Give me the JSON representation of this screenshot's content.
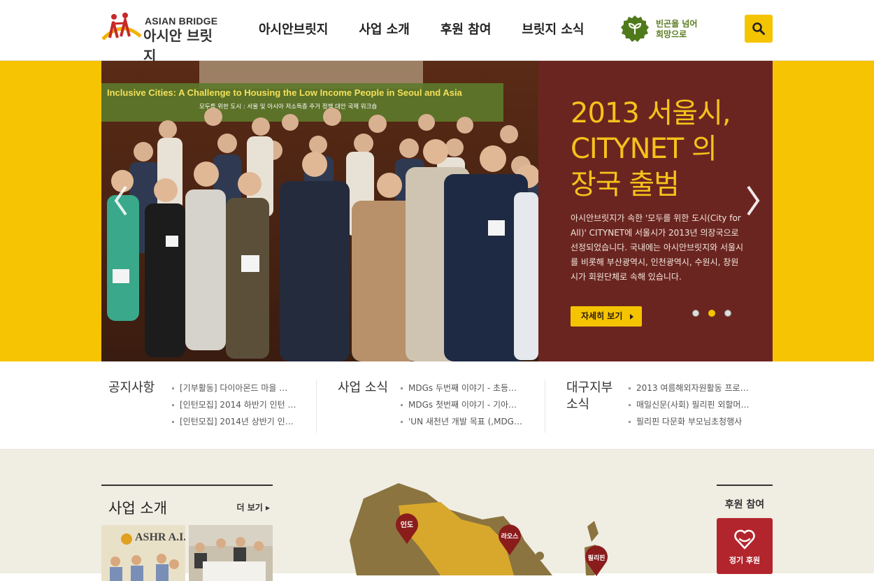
{
  "header": {
    "logo_en": "ASIAN BRIDGE",
    "logo_ko": "아시안 브릿지",
    "nav": [
      "아시안브릿지",
      "사업 소개",
      "후원 참여",
      "브릿지 소식"
    ],
    "slogan": "빈곤을 넘어\n희망으로",
    "search_icon": "search-icon"
  },
  "hero": {
    "banner_line1": "Inclusive Cities: A Challenge to Housing the Low Income People in Seoul and Asia",
    "banner_line2": "모두를 위한 도시 : 서울 및 아시아 저소득층 주거 정책 대안 국제 워크숍",
    "title": "2013 서울시,\nCITYNET 의\n장국 출범",
    "description": "아시안브릿지가 속한 '모두를 위한 도시(City for All)' CITYNET에 서울시가 2013년 의장국으로 선정되었습니다. 국내에는 아시안브릿지와 서울시를 비롯해 부산광역시, 인천광역시, 수원시, 창원시가 회원단체로 속해 있습니다.",
    "button": "자세히 보기",
    "slides": 3,
    "active_slide": 2
  },
  "notices": [
    {
      "title": "공지사항",
      "items": [
        "[기부활동] 다이아몬드 마을 …",
        "[인턴모집] 2014 하반기 인턴 …",
        "[인턴모집] 2014년 상반기 인…"
      ]
    },
    {
      "title": "사업 소식",
      "items": [
        "MDGs 두번째 이야기 - 초등…",
        "MDGs 첫번째 이야기 - 기아…",
        "'UN 새천년 개발 목표 (,MDG…"
      ]
    },
    {
      "title": "대구지부\n소식",
      "items": [
        "2013 여름해외자원활동 프로…",
        "매일신문(사회) 필리핀 외할머…",
        "필리핀 다문화 부모님초청행사"
      ]
    }
  ],
  "business": {
    "title": "사업 소개",
    "more": "더 보기",
    "thumb_text": "ASHR A.I.Y"
  },
  "map": {
    "pins": [
      "인도",
      "라오스",
      "필리핀"
    ]
  },
  "donate": {
    "title": "후원 참여",
    "button": "정기 후원"
  },
  "colors": {
    "accent": "#f5c400",
    "panel": "#6b2520",
    "title_yellow": "#f6c21b",
    "donate_red": "#b3252c",
    "pin_red": "#8b1c1c"
  }
}
